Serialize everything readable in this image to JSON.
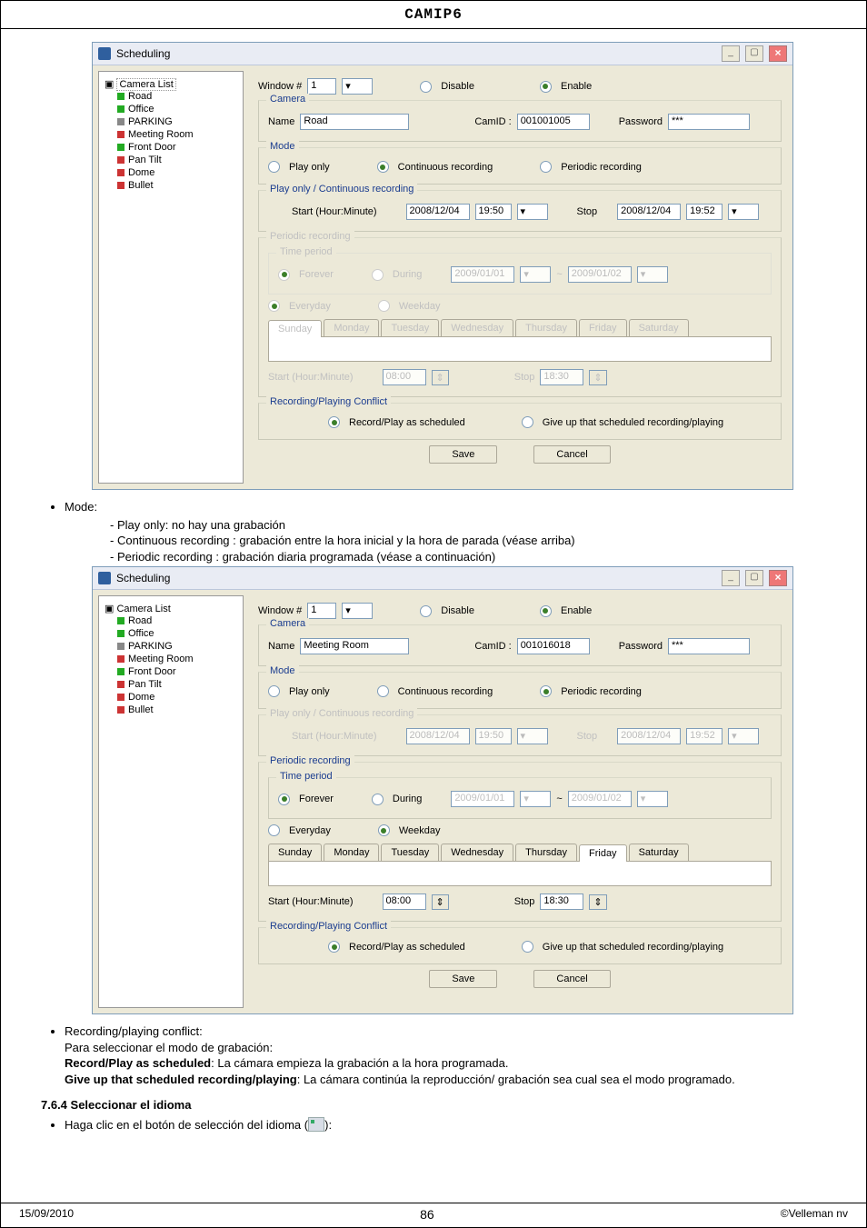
{
  "header_title": "CAMIP6",
  "footer": {
    "date": "15/09/2010",
    "page": "86",
    "copyright": "©Velleman nv"
  },
  "text": {
    "mode_label": "Mode:",
    "mode_play_only": "Play only: no hay una grabación",
    "mode_continuous": "Continuous recording : grabación entre la hora inicial y la hora de parada (véase arriba)",
    "mode_periodic": "Periodic recording : grabación diaria programada (véase a continuación)",
    "rec_conflict_label": "Recording/playing conflict:",
    "rec_conflict_1": "Para seleccionar el modo de grabación:",
    "rec_conflict_rp_bold": "Record/Play as scheduled",
    "rec_conflict_rp_rest": ": La cámara empieza la grabación a la hora programada.",
    "rec_conflict_gu_bold": "Give up that scheduled recording/playing",
    "rec_conflict_gu_rest": ": La cámara continúa la reproducción/ grabación sea cual sea el modo programado.",
    "section_764": "7.6.4 Seleccionar el idioma",
    "lang_line_pre": "Haga clic en el botón de selección del idioma (",
    "lang_line_post": "):"
  },
  "labels": {
    "window_num": "Window #",
    "disable": "Disable",
    "enable": "Enable",
    "camera": "Camera",
    "name": "Name",
    "camid": "CamID :",
    "password": "Password",
    "mode": "Mode",
    "play_only": "Play only",
    "continuous": "Continuous recording",
    "periodic_rec": "Periodic recording",
    "playcont": "Play only / Continuous recording",
    "start_hm": "Start (Hour:Minute)",
    "stop": "Stop",
    "periodic_box": "Periodic recording",
    "time_period": "Time period",
    "forever": "Forever",
    "during": "During",
    "everyday": "Everyday",
    "weekday": "Weekday",
    "sunday": "Sunday",
    "monday": "Monday",
    "tuesday": "Tuesday",
    "wednesday": "Wednesday",
    "thursday": "Thursday",
    "friday": "Friday",
    "saturday": "Saturday",
    "rp_conflict": "Recording/Playing Conflict",
    "rp_as_sched": "Record/Play as scheduled",
    "give_up": "Give up that scheduled recording/playing",
    "save": "Save",
    "cancel": "Cancel"
  },
  "win1": {
    "title": "Scheduling",
    "tree": {
      "root": "Camera List",
      "items": [
        "Road",
        "Office",
        "PARKING",
        "Meeting Room",
        "Front Door",
        "Pan Tilt",
        "Dome",
        "Bullet"
      ]
    },
    "window_num": "1",
    "enable_sel": "enable",
    "name": "Road",
    "camid": "001001005",
    "password": "***",
    "mode_sel": "continuous",
    "start_date": "2008/12/04",
    "start_time": "19:50",
    "stop_date": "2008/12/04",
    "stop_time": "19:52",
    "periodic_enabled": false,
    "tp_forever": true,
    "tp_during_from": "2009/01/01",
    "tp_during_to": "2009/01/02",
    "weekmode": "everyday",
    "hm_start": "08:00",
    "hm_stop": "18:30",
    "conflict": "record"
  },
  "win2": {
    "title": "Scheduling",
    "tree": {
      "root": "Camera List",
      "items": [
        "Road",
        "Office",
        "PARKING",
        "Meeting Room",
        "Front Door",
        "Pan Tilt",
        "Dome",
        "Bullet"
      ]
    },
    "window_num": "1",
    "enable_sel": "enable",
    "name": "Meeting Room",
    "camid": "001016018",
    "password": "***",
    "mode_sel": "periodic",
    "start_date": "2008/12/04",
    "start_time": "19:50",
    "stop_date": "2008/12/04",
    "stop_time": "19:52",
    "periodic_enabled": true,
    "tp_forever": true,
    "tp_during_from": "2009/01/01",
    "tp_during_to": "2009/01/02",
    "weekmode": "weekday",
    "hm_start": "08:00",
    "hm_stop": "18:30",
    "conflict": "record"
  }
}
